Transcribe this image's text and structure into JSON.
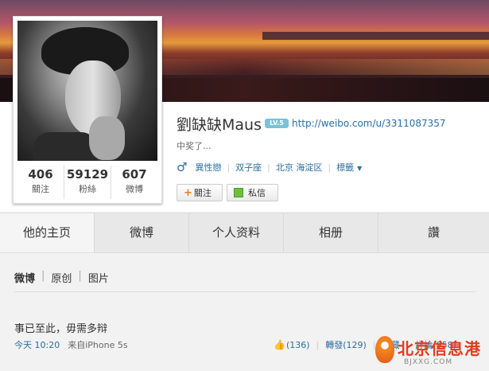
{
  "profile": {
    "name": "劉缺缺Maus",
    "badge": "LV.5",
    "url": "http://weibo.com/u/3311087357",
    "bio": "中奖了...",
    "gender_icon": "♂",
    "orientation": "異性戀",
    "zodiac": "双子座",
    "location": "北京 海淀区",
    "tags_label": "標籤",
    "stats": [
      {
        "num": "406",
        "label": "關注"
      },
      {
        "num": "59129",
        "label": "粉絲"
      },
      {
        "num": "607",
        "label": "微博"
      }
    ],
    "follow_label": "關注",
    "message_label": "私信"
  },
  "tabs": [
    "他的主页",
    "微博",
    "个人资料",
    "相册",
    "讚"
  ],
  "subnav": [
    "微博",
    "原创",
    "图片"
  ],
  "post": {
    "text": "事已至此，毋需多辩",
    "time": "今天 10:20",
    "source": "来自iPhone 5s",
    "likes": "(136)",
    "repost": "轉發(129)",
    "favorite": "收藏",
    "comment": "評論(958)"
  },
  "watermark": {
    "title": "北京信息港",
    "sub": "BJXXG.COM"
  },
  "colors": {
    "link": "#2a6ea0",
    "accent": "#f07a1b"
  }
}
